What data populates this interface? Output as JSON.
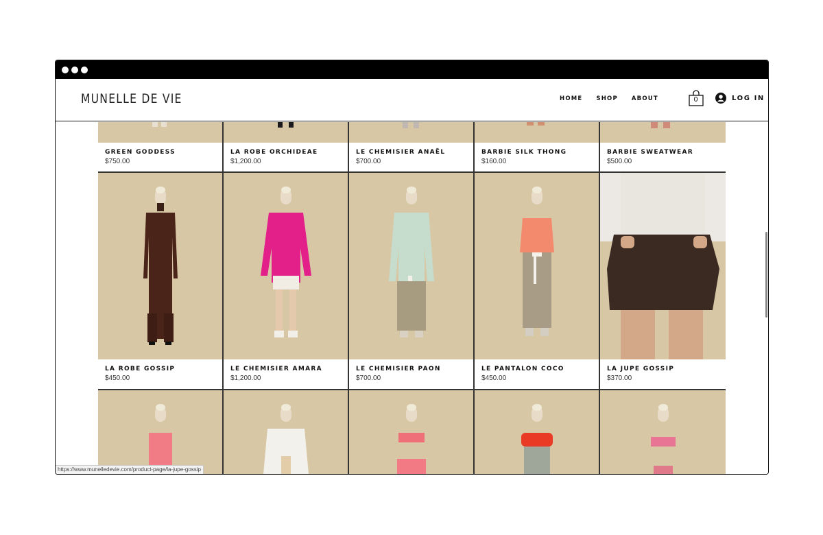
{
  "header": {
    "brand": "MUNELLE DE VIE",
    "nav": [
      {
        "label": "HOME"
      },
      {
        "label": "SHOP"
      },
      {
        "label": "ABOUT"
      }
    ],
    "cart_count": "0",
    "login_label": "LOG IN"
  },
  "products_row1": [
    {
      "name": "GREEN GODDESS",
      "price": "$750.00"
    },
    {
      "name": "LA ROBE ORCHIDEAE",
      "price": "$1,200.00"
    },
    {
      "name": "LE CHEMISIER ANAËL",
      "price": "$700.00"
    },
    {
      "name": "BARBIE SILK THONG",
      "price": "$160.00"
    },
    {
      "name": "BARBIE SWEATWEAR",
      "price": "$500.00"
    }
  ],
  "products_row2": [
    {
      "name": "LA ROBE GOSSIP",
      "price": "$450.00"
    },
    {
      "name": "LE CHEMISIER AMARA",
      "price": "$1,200.00"
    },
    {
      "name": "LE CHEMISIER PAON",
      "price": "$700.00"
    },
    {
      "name": "LE PANTALON COCO",
      "price": "$450.00"
    },
    {
      "name": "LA JUPE GOSSIP",
      "price": "$370.00"
    }
  ],
  "status_url": "https://www.munelledevie.com/product-page/la-jupe-gossip",
  "colors": {
    "photo_bg": "#d8c7a5",
    "accent_text": "#111111"
  }
}
